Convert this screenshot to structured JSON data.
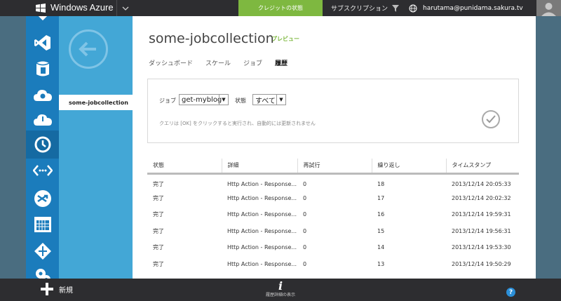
{
  "header": {
    "brand": "Windows Azure",
    "credit_button": "クレジットの状態",
    "subscriptions_label": "サブスクリプション",
    "user_email": "harutama@punidama.sakura.tv"
  },
  "sidebar": {
    "back_label": "back",
    "items": [
      {
        "label": "some-jobcollection"
      }
    ]
  },
  "main": {
    "title": "some-jobcollection",
    "badge": "プレビュー",
    "tabs": [
      {
        "label": "ダッシュボード"
      },
      {
        "label": "スケール"
      },
      {
        "label": "ジョブ"
      },
      {
        "label": "履歴"
      }
    ],
    "filter": {
      "job_label": "ジョブ",
      "job_value": "get-myblog",
      "status_label": "状態",
      "status_value": "すべて",
      "note": "クエリは [OK] をクリックすると実行され、自動的には更新されません"
    },
    "table": {
      "headers": [
        "状態",
        "詳細",
        "再試行",
        "繰り返し",
        "タイムスタンプ"
      ],
      "rows": [
        [
          "完了",
          "Http Action - Response...",
          "0",
          "18",
          "2013/12/14 20:05:33"
        ],
        [
          "完了",
          "Http Action - Response...",
          "0",
          "17",
          "2013/12/14 20:02:32"
        ],
        [
          "完了",
          "Http Action - Response...",
          "0",
          "16",
          "2013/12/14 19:59:31"
        ],
        [
          "完了",
          "Http Action - Response...",
          "0",
          "15",
          "2013/12/14 19:56:31"
        ],
        [
          "完了",
          "Http Action - Response...",
          "0",
          "14",
          "2013/12/14 19:53:30"
        ],
        [
          "完了",
          "Http Action - Response...",
          "0",
          "13",
          "2013/12/14 19:50:29"
        ]
      ]
    }
  },
  "footer": {
    "new_label": "新規",
    "info_label": "履歴詳細の表示",
    "help": "?"
  },
  "colors": {
    "accent_green": "#7eb840",
    "rail_blue": "#1b7cbc",
    "panel_blue": "#43a7d6",
    "bar_dark": "#2d2d30"
  }
}
